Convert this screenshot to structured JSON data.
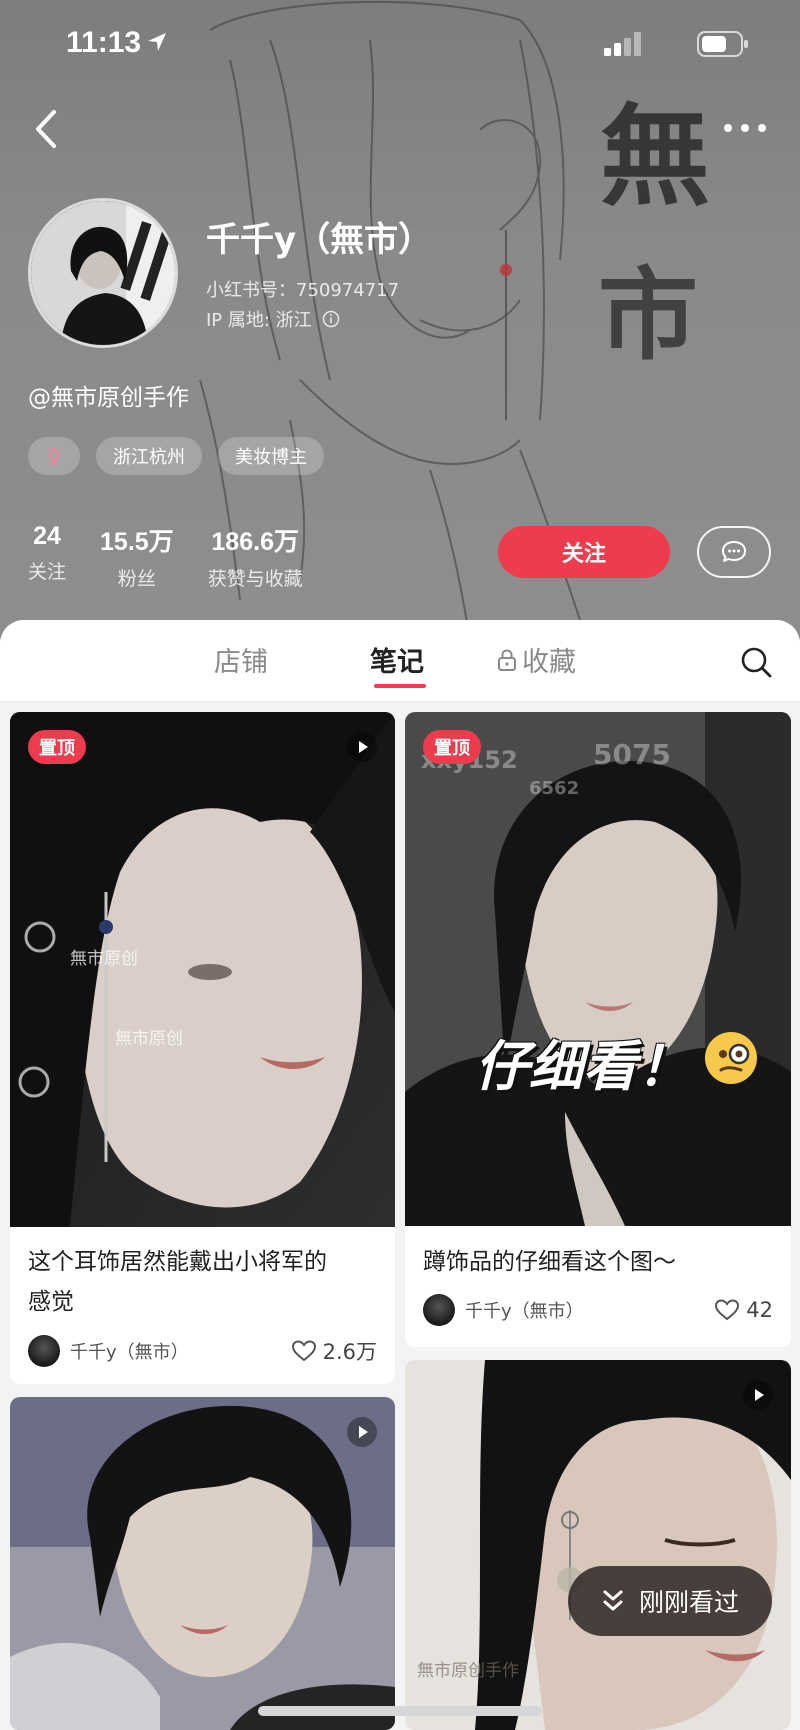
{
  "status_bar": {
    "time": "11:13"
  },
  "profile": {
    "nickname": "千千y（無市）",
    "red_id": "小红书号：750974717",
    "ip": "IP 属地: 浙江",
    "bio": "@無市原创手作",
    "tags": [
      "浙江杭州",
      "美妆博主"
    ],
    "gender": "♀",
    "stats": [
      {
        "value": "24",
        "label": "关注"
      },
      {
        "value": "15.5万",
        "label": "粉丝"
      },
      {
        "value": "186.6万",
        "label": "获赞与收藏"
      }
    ],
    "follow_label": "关注",
    "header_art_text": [
      "無",
      "市"
    ]
  },
  "tabs": {
    "shop": "店铺",
    "notes": "笔记",
    "collections": "收藏"
  },
  "notes": [
    {
      "pinned": "置顶",
      "title_line1": "这个耳饰居然能戴出小将军的",
      "title_line2": "感觉",
      "author": "千千y（無市）",
      "likes": "2.6万",
      "watermark1": "無市原创",
      "watermark2": "無市原创"
    },
    {
      "pinned": "置顶",
      "title_line1": "蹲饰品的仔细看这个图～",
      "author": "千千y（無市）",
      "likes": "42",
      "overlay": "仔细看！",
      "wm_a": "xxy152",
      "wm_b": "5075",
      "wm_c": "6562"
    },
    {
      "type": "video"
    },
    {
      "type": "video",
      "watermark": "無市原创手作"
    }
  ],
  "float_button": {
    "label": "刚刚看过"
  },
  "colors": {
    "accent": "#ee3c4e",
    "header_bg": "#8a8a8a"
  }
}
